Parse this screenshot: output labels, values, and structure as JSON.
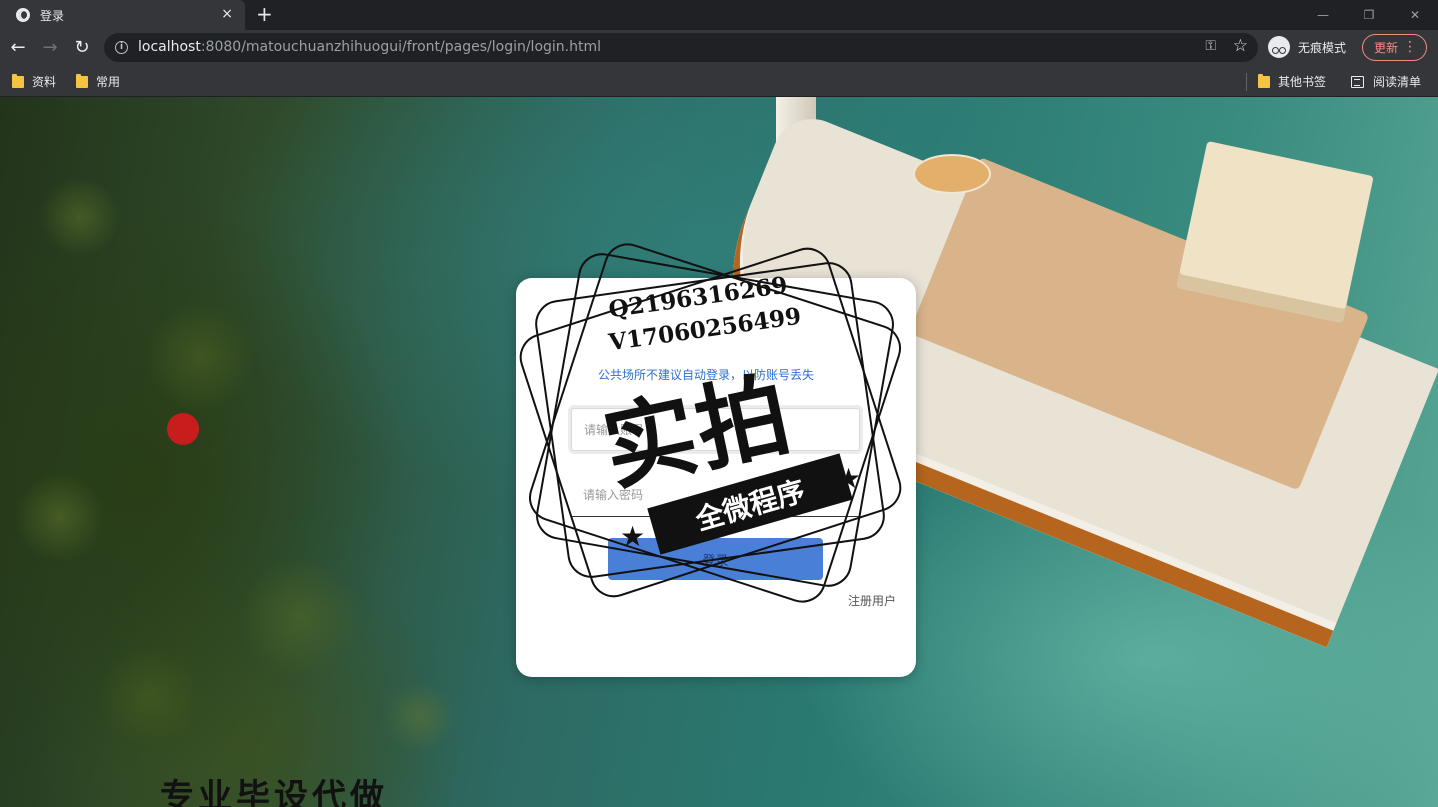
{
  "browser": {
    "tab_title": "登录",
    "tab_close": "×",
    "new_tab": "+",
    "window_min": "—",
    "window_restore": "❐",
    "window_close": "✕",
    "url_host": "localhost",
    "url_rest": ":8080/matouchuanzhihuogui/front/pages/login/login.html",
    "incognito_label": "无痕模式",
    "update_label": "更新",
    "bookmarks": [
      "资料",
      "常用"
    ],
    "other_bookmarks": "其他书签",
    "reading_list": "阅读清单"
  },
  "login": {
    "notice": "公共场所不建议自动登录，以防账号丢失",
    "username_placeholder": "请输入账号",
    "password_placeholder": "请输入密码",
    "login_button": "登录",
    "register_link": "注册用户"
  },
  "watermark": {
    "qq": "Q2196316269",
    "wechat": "V17060256499",
    "big_text": "实拍",
    "banner_text": "全微程序",
    "bottom_text": "专业毕设代做"
  },
  "colors": {
    "primary_button": "#4a7fd8",
    "notice_text": "#2f6fd0",
    "update_accent": "#f28b82"
  }
}
